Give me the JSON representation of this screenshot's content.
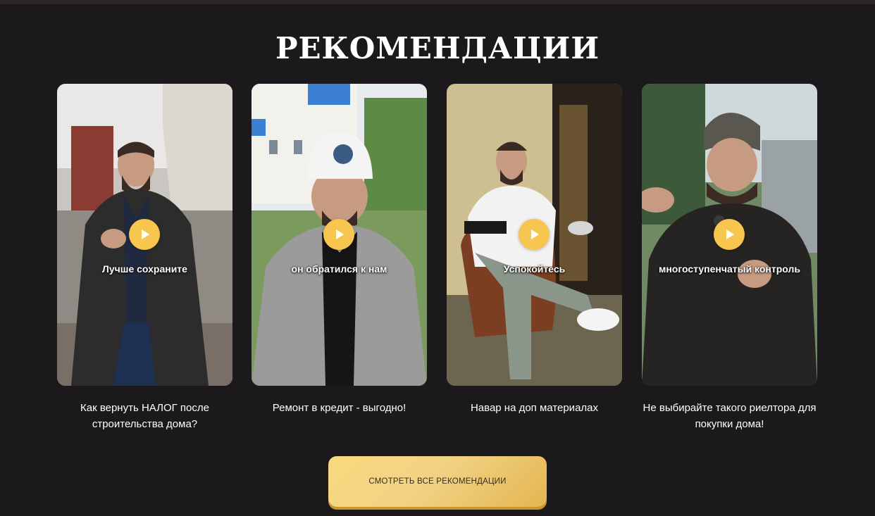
{
  "section": {
    "title": "РЕКОМЕНДАЦИИ"
  },
  "cards": [
    {
      "overlay_text": "Лучше сохраните",
      "title": "Как вернуть НАЛОГ после строительства дома?"
    },
    {
      "overlay_text": "он обратился к нам",
      "title": "Ремонт в кредит - выгодно!"
    },
    {
      "overlay_text": "Успокойтесь",
      "title": "Навар на доп материалах"
    },
    {
      "overlay_text": "многоступенчатый контроль",
      "title": "Не выбирайте такого риелтора для покупки дома!"
    }
  ],
  "cta": {
    "label": "СМОТРЕТЬ ВСЕ РЕКОМЕНДАЦИИ"
  },
  "icons": {
    "play": "play-icon"
  },
  "colors": {
    "background": "#1c191c",
    "accent": "#f6c64f",
    "text": "#ffffff"
  }
}
